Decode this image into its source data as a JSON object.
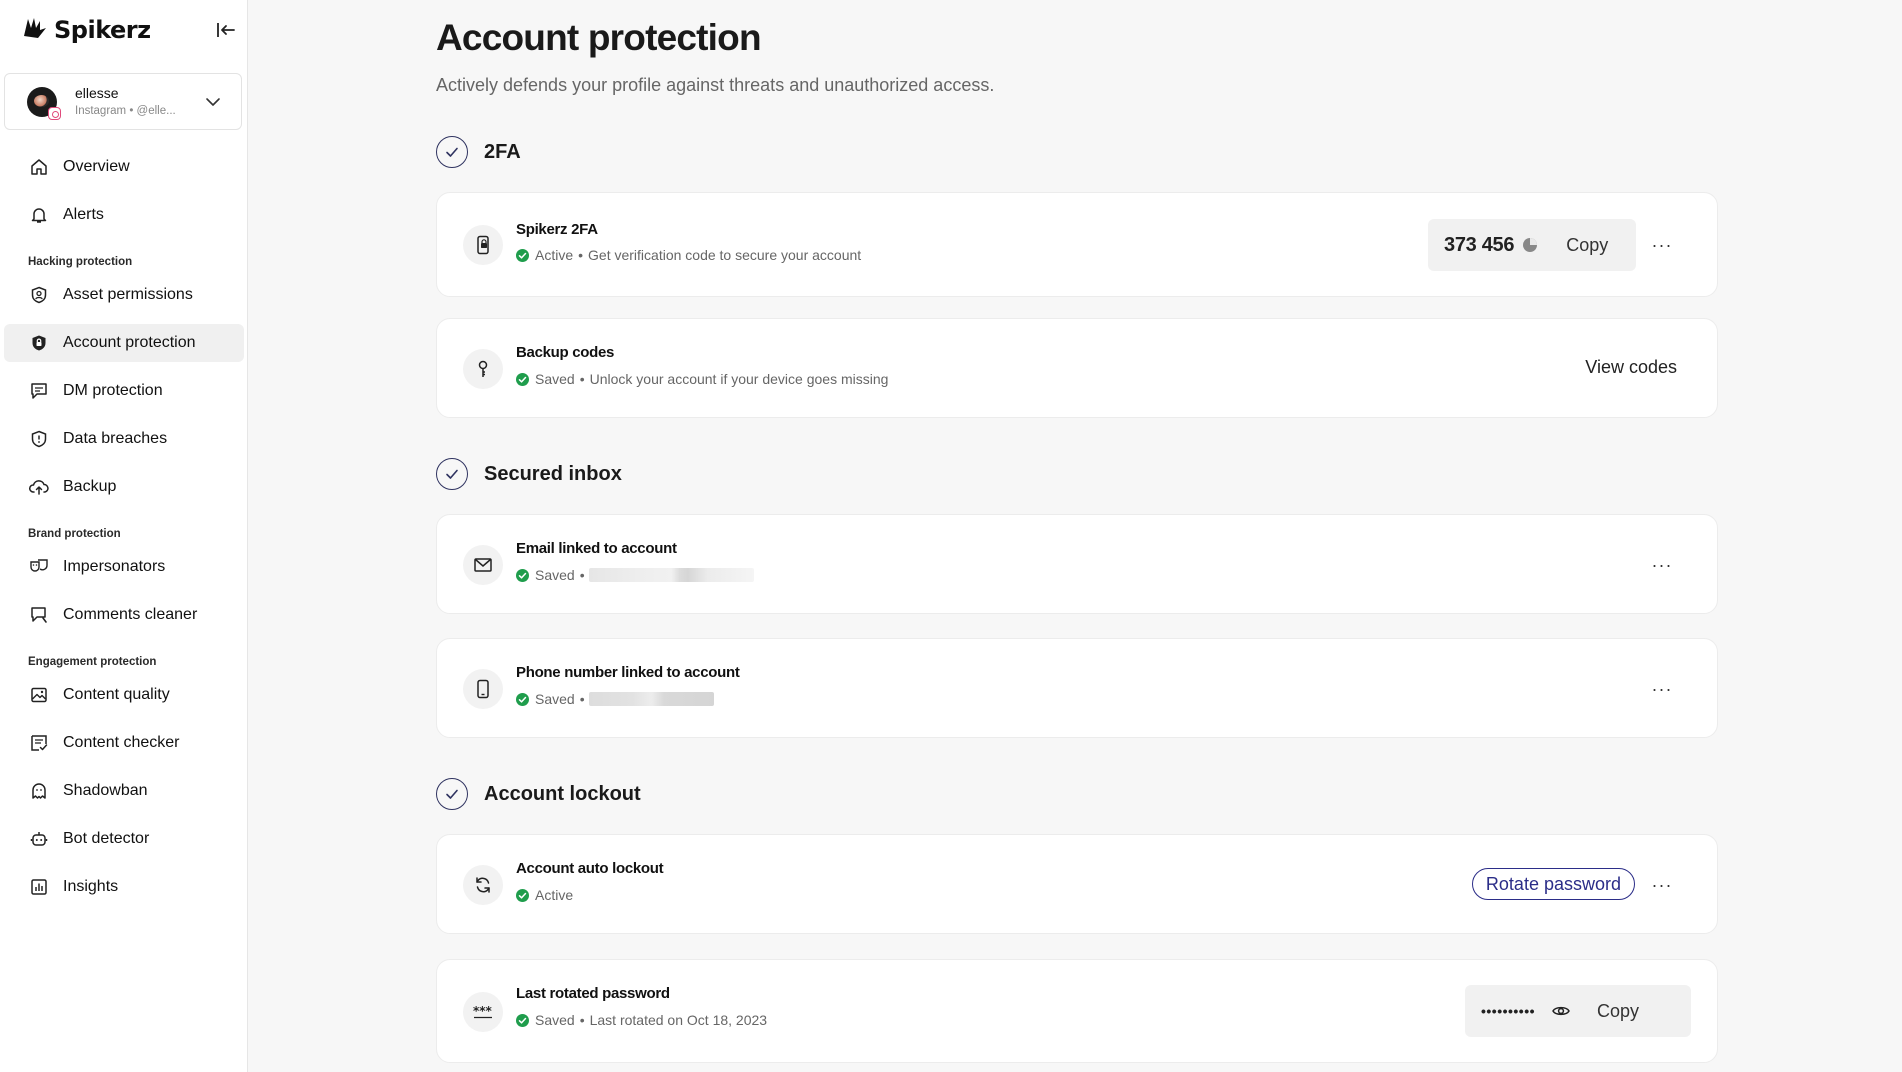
{
  "app": {
    "brand_name": "Spikerz"
  },
  "account": {
    "name": "ellesse",
    "subtitle": "Instagram • @elle..."
  },
  "nav": {
    "overview": "Overview",
    "alerts": "Alerts",
    "hacking_section": "Hacking protection",
    "asset_permissions": "Asset permissions",
    "account_protection": "Account protection",
    "dm_protection": "DM protection",
    "data_breaches": "Data breaches",
    "backup": "Backup",
    "brand_section": "Brand protection",
    "impersonators": "Impersonators",
    "comments_cleaner": "Comments cleaner",
    "engagement_section": "Engagement protection",
    "content_quality": "Content quality",
    "content_checker": "Content checker",
    "shadowban": "Shadowban",
    "bot_detector": "Bot detector",
    "insights": "Insights",
    "active_item": "account_protection"
  },
  "page": {
    "title": "Account protection",
    "subtitle": "Actively defends your profile against threats and unauthorized access."
  },
  "sections": {
    "twofa": {
      "title": "2FA",
      "spikerz_2fa": {
        "title": "Spikerz 2FA",
        "status": "Active",
        "description": "Get verification code to secure your account",
        "code": "373 456",
        "copy_label": "Copy"
      },
      "backup_codes": {
        "title": "Backup codes",
        "status": "Saved",
        "description": "Unlock your account if your device goes missing",
        "action_label": "View codes"
      }
    },
    "secured_inbox": {
      "title": "Secured inbox",
      "email": {
        "title": "Email linked to account",
        "status": "Saved"
      },
      "phone": {
        "title": "Phone number linked to account",
        "status": "Saved"
      }
    },
    "account_lockout": {
      "title": "Account lockout",
      "auto_lockout": {
        "title": "Account auto lockout",
        "status": "Active",
        "action_label": "Rotate password"
      },
      "last_rotated": {
        "title": "Last rotated password",
        "status": "Saved",
        "description": "Last rotated on Oct 18, 2023",
        "masked_password": "••••••••••",
        "copy_label": "Copy"
      }
    }
  },
  "common": {
    "separator": "•",
    "more_label": "···"
  },
  "colors": {
    "accent": "#2b2d88",
    "status_green": "#1f9d4c",
    "check_circle": "#2f3360",
    "page_bg": "#f7f7f7"
  }
}
